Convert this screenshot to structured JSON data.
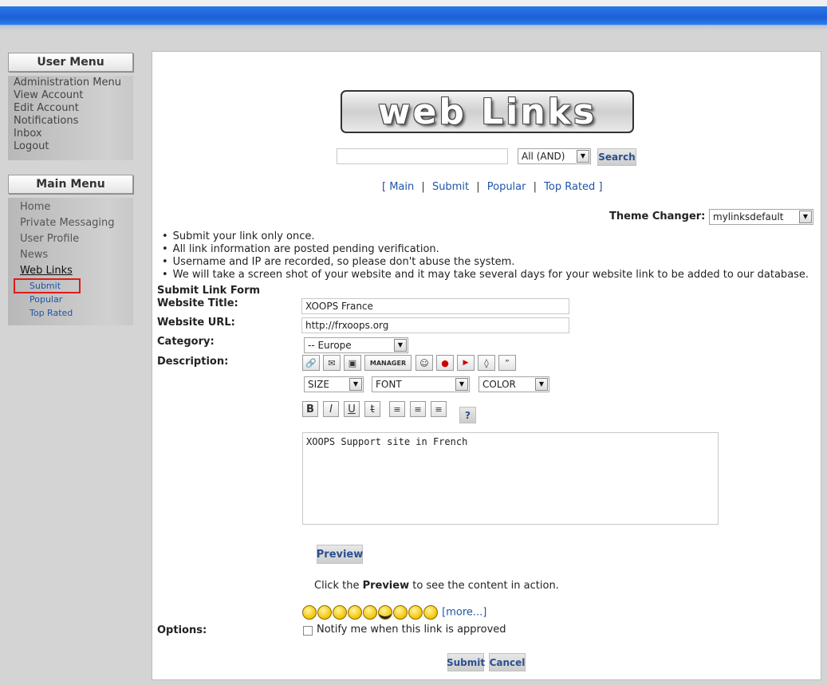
{
  "user_menu": {
    "title": "User Menu",
    "items": [
      "Administration Menu",
      "View Account",
      "Edit Account",
      "Notifications",
      "Inbox",
      "Logout"
    ]
  },
  "main_menu": {
    "title": "Main Menu",
    "items": [
      "Home",
      "Private Messaging",
      "User Profile",
      "News",
      "Web Links"
    ],
    "sub_items": [
      "Submit",
      "Popular",
      "Top Rated"
    ]
  },
  "header": {
    "logo_text": "web Links",
    "search": {
      "value": "",
      "mode": "All (AND)",
      "button": "Search"
    },
    "nav": [
      "Main",
      "Submit",
      "Popular",
      "Top Rated"
    ],
    "theme_label": "Theme Changer:",
    "theme_value": "mylinksdefault"
  },
  "rules": [
    "Submit your link only once.",
    "All link information are posted pending verification.",
    "Username and IP are recorded, so please don't abuse the system.",
    "We will take a screen shot of your website and it may take several days for your website link to be added to our database."
  ],
  "form": {
    "title": "Submit Link Form",
    "website_title_label": "Website Title:",
    "website_title_value": "XOOPS France",
    "website_url_label": "Website URL:",
    "website_url_value": "http://frxoops.org",
    "category_label": "Category:",
    "category_value": "-- Europe",
    "description_label": "Description:",
    "manager_label": "MANAGER",
    "size_label": "SIZE",
    "font_label": "FONT",
    "color_label": "COLOR",
    "bold": "B",
    "italic": "I",
    "underline": "U",
    "strike": "t",
    "help": "?",
    "description_value": "XOOPS Support site in French",
    "preview_button": "Preview",
    "preview_hint_before": "Click the ",
    "preview_hint_bold": "Preview",
    "preview_hint_after": " to see the content in action.",
    "more_link": "more...",
    "options_label": "Options:",
    "notify_label": "Notify me when this link is approved",
    "submit_button": "Submit",
    "cancel_button": "Cancel"
  }
}
